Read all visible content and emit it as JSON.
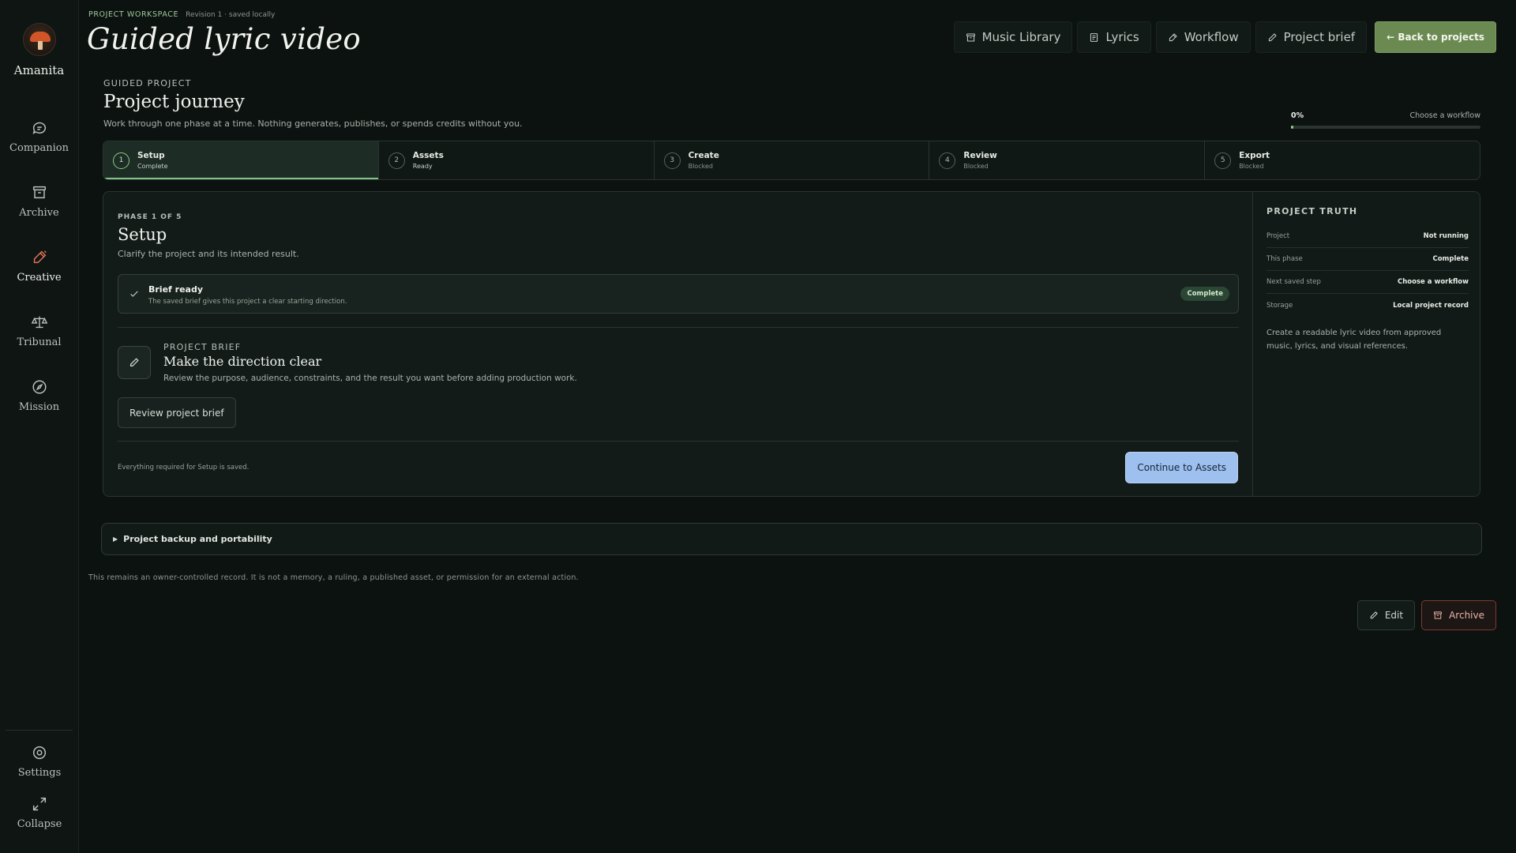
{
  "app": {
    "brand": "Amanita"
  },
  "sidebar": {
    "items": [
      {
        "label": "Companion",
        "icon": "chat-bubble-icon"
      },
      {
        "label": "Archive",
        "icon": "archive-box-icon"
      },
      {
        "label": "Creative",
        "icon": "pen-icon",
        "active": true
      },
      {
        "label": "Tribunal",
        "icon": "scales-icon"
      },
      {
        "label": "Mission",
        "icon": "compass-icon"
      }
    ],
    "bottom": [
      {
        "label": "Settings",
        "icon": "gear-icon"
      },
      {
        "label": "Collapse",
        "icon": "expand-arrows-icon"
      }
    ]
  },
  "header": {
    "eyebrow": "PROJECT WORKSPACE",
    "revision": "Revision 1 · saved locally",
    "title": "Guided lyric video",
    "nav": [
      {
        "label": "Music Library",
        "icon": "archive-icon"
      },
      {
        "label": "Lyrics",
        "icon": "document-icon"
      },
      {
        "label": "Workflow",
        "icon": "pen-icon"
      },
      {
        "label": "Project brief",
        "icon": "pencil-icon"
      }
    ],
    "back_label": "← Back to projects"
  },
  "journey": {
    "label": "GUIDED PROJECT",
    "title": "Project journey",
    "description": "Work through one phase at a time. Nothing generates, publishes, or spends credits without you.",
    "progress_text": "0%",
    "progress_value": 0,
    "progress_label": "Choose a workflow",
    "steps": [
      {
        "num": "1",
        "name": "Setup",
        "status": "Complete"
      },
      {
        "num": "2",
        "name": "Assets",
        "status": "Ready"
      },
      {
        "num": "3",
        "name": "Create",
        "status": "Blocked"
      },
      {
        "num": "4",
        "name": "Review",
        "status": "Blocked"
      },
      {
        "num": "5",
        "name": "Export",
        "status": "Blocked"
      }
    ]
  },
  "phase": {
    "label": "PHASE 1 OF 5",
    "title": "Setup",
    "description": "Clarify the project and its intended result.",
    "brief_title": "Brief ready",
    "brief_sub": "The saved brief gives this project a clear starting direction.",
    "brief_badge": "Complete",
    "pb_label": "PROJECT BRIEF",
    "pb_title": "Make the direction clear",
    "pb_desc": "Review the purpose, audience, constraints, and the result you want before adding production work.",
    "review_label": "Review project brief",
    "saved_note": "Everything required for Setup is saved.",
    "continue_label": "Continue to Assets"
  },
  "truth": {
    "title": "PROJECT TRUTH",
    "rows": [
      {
        "k": "Project",
        "v": "Not running"
      },
      {
        "k": "This phase",
        "v": "Complete"
      },
      {
        "k": "Next saved step",
        "v": "Choose a workflow"
      },
      {
        "k": "Storage",
        "v": "Local project record"
      }
    ],
    "description": "Create a readable lyric video from approved music, lyrics, and visual references."
  },
  "backup": {
    "label": "Project backup and portability"
  },
  "footer_note": "This remains an owner-controlled record. It is not a memory, a ruling, a published asset, or permission for an external action.",
  "actions": {
    "edit": "Edit",
    "archive": "Archive"
  },
  "colors": {
    "accent_green": "#8fd08a",
    "primary_button": "#6b8a52",
    "continue_button": "#9ec0ee",
    "archive_border": "#7d3a2f"
  }
}
